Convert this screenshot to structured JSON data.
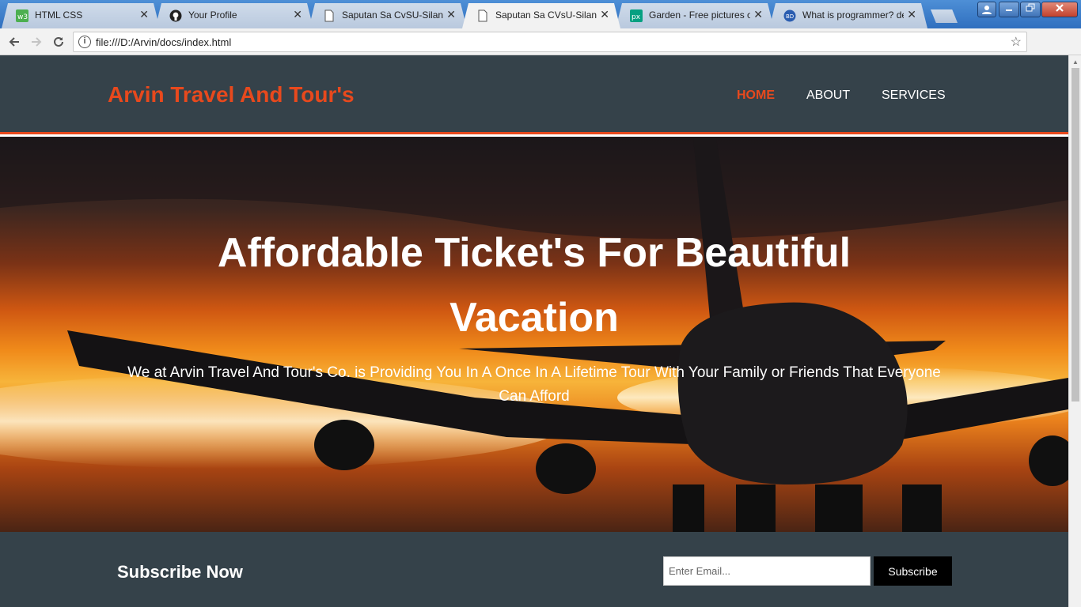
{
  "browser": {
    "tabs": [
      {
        "title": "HTML CSS",
        "favicon": "w3schools-icon",
        "active": false
      },
      {
        "title": "Your Profile",
        "favicon": "github-icon",
        "active": false
      },
      {
        "title": "Saputan Sa CvSU-Silang",
        "favicon": "page-icon",
        "active": false
      },
      {
        "title": "Saputan Sa CVsU-Silang",
        "favicon": "page-icon",
        "active": true
      },
      {
        "title": "Garden - Free pictures on",
        "favicon": "pexels-icon",
        "active": false
      },
      {
        "title": "What is programmer? de",
        "favicon": "webopedia-icon",
        "active": false
      }
    ],
    "close_glyph": "✕",
    "url": "file:///D:/Arvin/docs/index.html"
  },
  "site": {
    "brand": "Arvin Travel And Tour's",
    "nav": [
      "HOME",
      "ABOUT",
      "SERVICES"
    ],
    "hero_title": "Affordable Ticket's For Beautiful Vacation",
    "hero_subtitle": "We at Arvin Travel And Tour's Co. is Providing You In A Once In A Lifetime Tour With Your Family or Friends That Everyone Can Afford",
    "subscribe_heading": "Subscribe Now",
    "email_placeholder": "Enter Email...",
    "subscribe_button": "Subscribe"
  },
  "colors": {
    "brand_accent": "#e8491d",
    "header_bg": "#35424a",
    "button_bg": "#000000"
  }
}
